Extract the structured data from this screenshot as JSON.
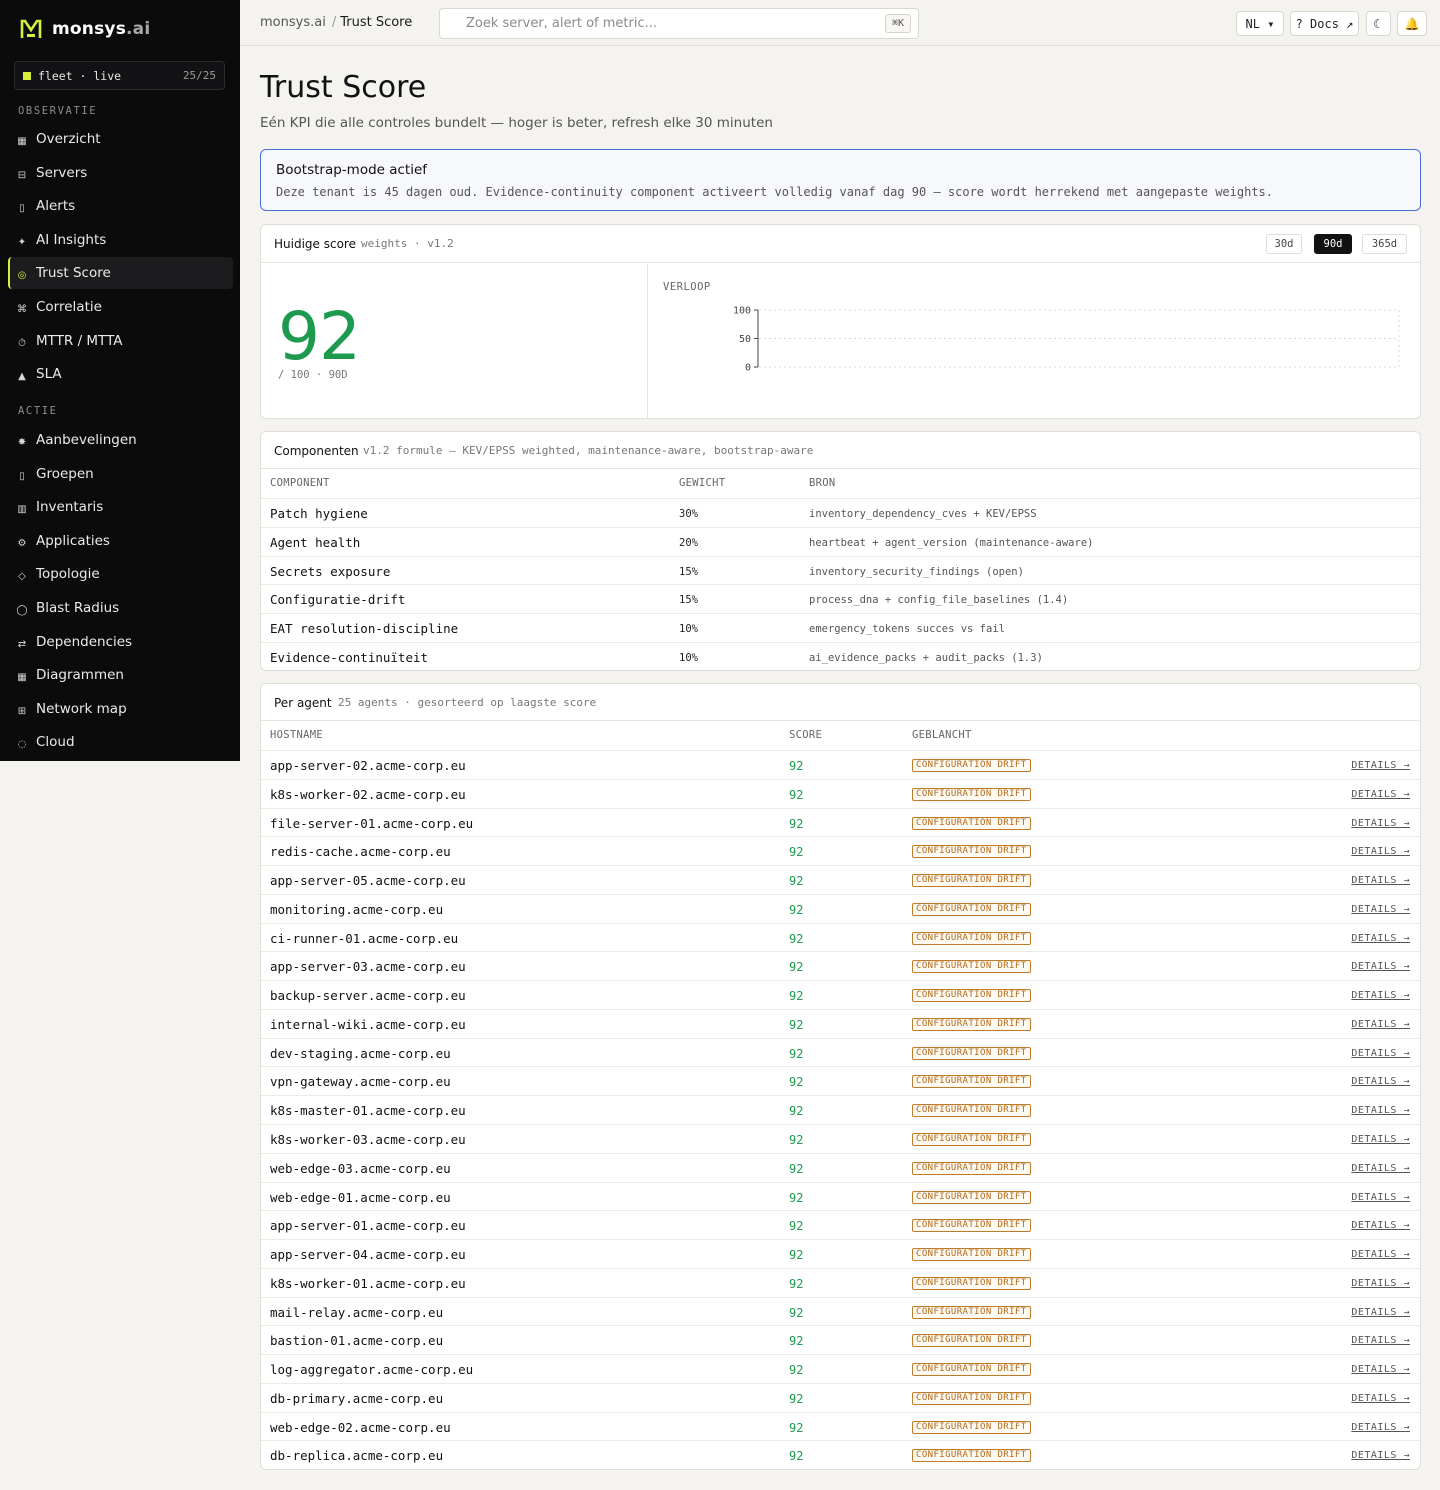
{
  "brand": {
    "name": "monsys",
    "tld": ".ai",
    "accent": "#d8f03a"
  },
  "fleet": {
    "label": "fleet · live",
    "count": "25/25"
  },
  "nav": {
    "section_observatie": "OBSERVATIE",
    "observatie": [
      {
        "label": "Overzicht",
        "icon": "dashboard-icon",
        "glyph": "▦"
      },
      {
        "label": "Servers",
        "icon": "server-icon",
        "glyph": "⊟"
      },
      {
        "label": "Alerts",
        "icon": "bell-icon",
        "glyph": "▯"
      },
      {
        "label": "AI Insights",
        "icon": "sparkle-icon",
        "glyph": "✦"
      },
      {
        "label": "Trust Score",
        "icon": "target-icon",
        "glyph": "◎",
        "active": true
      },
      {
        "label": "Correlatie",
        "icon": "command-icon",
        "glyph": "⌘"
      },
      {
        "label": "MTTR / MTTA",
        "icon": "stopwatch-icon",
        "glyph": "⏱"
      },
      {
        "label": "SLA",
        "icon": "triangle-icon",
        "glyph": "▲"
      }
    ],
    "section_actie": "ACTIE",
    "actie": [
      {
        "label": "Aanbevelingen",
        "icon": "asterisk-icon",
        "glyph": "✸"
      },
      {
        "label": "Groepen",
        "icon": "folder-icon",
        "glyph": "▯"
      },
      {
        "label": "Inventaris",
        "icon": "inventory-icon",
        "glyph": "▥"
      },
      {
        "label": "Applicaties",
        "icon": "gear-icon",
        "glyph": "⚙"
      },
      {
        "label": "Topologie",
        "icon": "diamond-icon",
        "glyph": "◇"
      },
      {
        "label": "Blast Radius",
        "icon": "circle-icon",
        "glyph": "◯"
      },
      {
        "label": "Dependencies",
        "icon": "swap-icon",
        "glyph": "⇄"
      },
      {
        "label": "Diagrammen",
        "icon": "diagram-icon",
        "glyph": "▦"
      },
      {
        "label": "Network map",
        "icon": "grid-icon",
        "glyph": "⊞"
      },
      {
        "label": "Cloud",
        "icon": "cloud-icon",
        "glyph": "◌"
      }
    ]
  },
  "topbar": {
    "crumb_root": "monsys.ai",
    "crumb_sep": "/",
    "crumb_current": "Trust Score",
    "search_placeholder": "Zoek server, alert of metric...",
    "search_kbd": "⌘K",
    "lang": "NL ▾",
    "docs": "? Docs ↗",
    "theme_glyph": "☾",
    "notif_glyph": "🔔"
  },
  "page": {
    "title": "Trust Score",
    "subtitle": "Eén KPI die alle controles bundelt — hoger is beter, refresh elke 30 minuten"
  },
  "bootstrap_alert": {
    "title": "Bootstrap-mode actief",
    "text": "Deze tenant is 45 dagen oud. Evidence-continuity component activeert volledig vanaf dag 90 — score wordt herrekend met aangepaste weights."
  },
  "score_card": {
    "title": "Huidige score",
    "meta": "weights · v1.2",
    "ranges": [
      "30d",
      "90d",
      "365d"
    ],
    "active_range": "90d",
    "value": "92",
    "sub": "/ 100 · 90D",
    "verloop_label": "VERLOOP",
    "score_color": "#1e9a4f"
  },
  "chart_data": {
    "type": "line",
    "title": "VERLOOP",
    "ylim": [
      0,
      100
    ],
    "yticks": [
      "100",
      "50",
      "0"
    ],
    "series": [],
    "grid": true
  },
  "components": {
    "title": "Componenten",
    "meta": "v1.2 formule — KEV/EPSS weighted, maintenance-aware, bootstrap-aware",
    "headers": [
      "COMPONENT",
      "GEWICHT",
      "BRON"
    ],
    "rows": [
      {
        "name": "Patch hygiene",
        "weight": "30%",
        "source": "inventory_dependency_cves + KEV/EPSS"
      },
      {
        "name": "Agent health",
        "weight": "20%",
        "source": "heartbeat + agent_version (maintenance-aware)"
      },
      {
        "name": "Secrets exposure",
        "weight": "15%",
        "source": "inventory_security_findings (open)"
      },
      {
        "name": "Configuratie-drift",
        "weight": "15%",
        "source": "process_dna + config_file_baselines (1.4)"
      },
      {
        "name": "EAT resolution-discipline",
        "weight": "10%",
        "source": "emergency_tokens succes vs fail"
      },
      {
        "name": "Evidence-continuïteit",
        "weight": "10%",
        "source": "ai_evidence_packs + audit_packs (1.3)"
      }
    ]
  },
  "agents": {
    "title": "Per agent",
    "meta": "25 agents · gesorteerd op laagste score",
    "headers": [
      "HOSTNAME",
      "SCORE",
      "GEBLANCHT"
    ],
    "badge": "CONFIGURATION DRIFT",
    "details": "DETAILS →",
    "rows": [
      {
        "host": "app-server-02.acme-corp.eu",
        "score": "92"
      },
      {
        "host": "k8s-worker-02.acme-corp.eu",
        "score": "92"
      },
      {
        "host": "file-server-01.acme-corp.eu",
        "score": "92"
      },
      {
        "host": "redis-cache.acme-corp.eu",
        "score": "92"
      },
      {
        "host": "app-server-05.acme-corp.eu",
        "score": "92"
      },
      {
        "host": "monitoring.acme-corp.eu",
        "score": "92"
      },
      {
        "host": "ci-runner-01.acme-corp.eu",
        "score": "92"
      },
      {
        "host": "app-server-03.acme-corp.eu",
        "score": "92"
      },
      {
        "host": "backup-server.acme-corp.eu",
        "score": "92"
      },
      {
        "host": "internal-wiki.acme-corp.eu",
        "score": "92"
      },
      {
        "host": "dev-staging.acme-corp.eu",
        "score": "92"
      },
      {
        "host": "vpn-gateway.acme-corp.eu",
        "score": "92"
      },
      {
        "host": "k8s-master-01.acme-corp.eu",
        "score": "92"
      },
      {
        "host": "k8s-worker-03.acme-corp.eu",
        "score": "92"
      },
      {
        "host": "web-edge-03.acme-corp.eu",
        "score": "92"
      },
      {
        "host": "web-edge-01.acme-corp.eu",
        "score": "92"
      },
      {
        "host": "app-server-01.acme-corp.eu",
        "score": "92"
      },
      {
        "host": "app-server-04.acme-corp.eu",
        "score": "92"
      },
      {
        "host": "k8s-worker-01.acme-corp.eu",
        "score": "92"
      },
      {
        "host": "mail-relay.acme-corp.eu",
        "score": "92"
      },
      {
        "host": "bastion-01.acme-corp.eu",
        "score": "92"
      },
      {
        "host": "log-aggregator.acme-corp.eu",
        "score": "92"
      },
      {
        "host": "db-primary.acme-corp.eu",
        "score": "92"
      },
      {
        "host": "web-edge-02.acme-corp.eu",
        "score": "92"
      },
      {
        "host": "db-replica.acme-corp.eu",
        "score": "92"
      }
    ]
  }
}
